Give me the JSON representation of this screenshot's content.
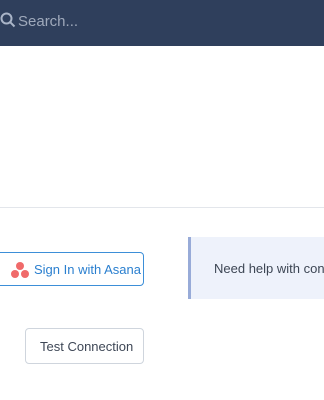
{
  "header": {
    "search": {
      "placeholder": "Search..."
    }
  },
  "integration": {
    "signin_label": "Sign In with Asana",
    "help_text": "Need help with conn",
    "test_label": "Test Connection"
  },
  "icons": {
    "search": "search-icon",
    "asana": "asana-logo-icon"
  },
  "colors": {
    "topbar": "#2f3f5c",
    "accent": "#3d8fd8",
    "asana": "#f06a6a",
    "help_panel": "#eef2fb",
    "help_border": "#98abd8"
  }
}
